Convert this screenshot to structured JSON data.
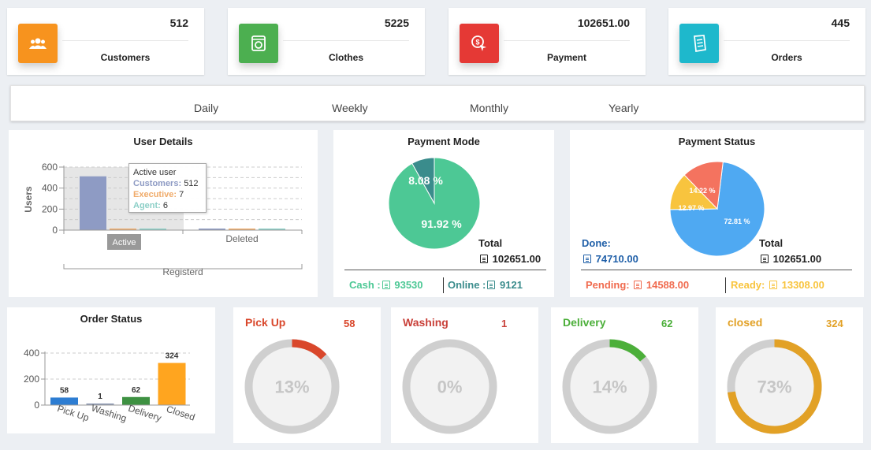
{
  "stats": [
    {
      "value": "512",
      "label": "Customers",
      "color": "#f7931e",
      "icon": "users-icon"
    },
    {
      "value": "5225",
      "label": "Clothes",
      "color": "#4caf50",
      "icon": "washing-machine-icon"
    },
    {
      "value": "102651.00",
      "label": "Payment",
      "color": "#e53935",
      "icon": "payment-icon"
    },
    {
      "value": "445",
      "label": "Orders",
      "color": "#1eb8cc",
      "icon": "receipt-icon"
    }
  ],
  "tabs": [
    "Daily",
    "Weekly",
    "Monthly",
    "Yearly"
  ],
  "user_details": {
    "title": "User Details",
    "tooltip": {
      "title": "Active user",
      "customers_label": "Customers:",
      "customers": "512",
      "executive_label": "Executive:",
      "executive": "7",
      "agent_label": "Agent:",
      "agent": "6"
    },
    "active_label": "Active"
  },
  "payment_mode": {
    "title": "Payment Mode",
    "total_label": "Total",
    "total": "102651.00",
    "cash_label": "Cash :",
    "cash": "93530",
    "online_label": "Online :",
    "online": "9121"
  },
  "payment_status": {
    "title": "Payment Status",
    "done_label": "Done:",
    "done": "74710.00",
    "total_label": "Total",
    "total": "102651.00",
    "pending_label": "Pending:",
    "pending": "14588.00",
    "ready_label": "Ready:",
    "ready": "13308.00"
  },
  "order_status": {
    "title": "Order Status"
  },
  "rings": [
    {
      "title": "Pick Up",
      "count": "58",
      "percent_label": "13%",
      "fraction": 0.13,
      "color": "#d9472b"
    },
    {
      "title": "Washing",
      "count": "1",
      "percent_label": "0%",
      "fraction": 0.0,
      "color": "#c9413a"
    },
    {
      "title": "Delivery",
      "count": "62",
      "percent_label": "14%",
      "fraction": 0.14,
      "color": "#4caf3a"
    },
    {
      "title": "closed",
      "count": "324",
      "percent_label": "73%",
      "fraction": 0.73,
      "color": "#e2a126"
    }
  ],
  "chart_data": [
    {
      "type": "bar",
      "title": "User Details",
      "ylabel": "Users",
      "categories": [
        "Active",
        "Deleted"
      ],
      "xlabel": "Registerd",
      "series": [
        {
          "name": "Customers",
          "values": [
            512,
            0
          ],
          "color": "#8e9bc4"
        },
        {
          "name": "Executive",
          "values": [
            7,
            0
          ],
          "color": "#f0ab6a"
        },
        {
          "name": "Agent",
          "values": [
            6,
            0
          ],
          "color": "#8ccfc7"
        }
      ],
      "ylim": [
        0,
        600
      ],
      "yticks": [
        0,
        200,
        400,
        600
      ]
    },
    {
      "type": "pie",
      "title": "Payment Mode",
      "labels": [
        "Cash",
        "Online"
      ],
      "values": [
        91.92,
        8.08
      ],
      "value_labels": [
        "91.92 %",
        "8.08 %"
      ],
      "colors": [
        "#4dc895",
        "#3a8c8c"
      ]
    },
    {
      "type": "pie",
      "title": "Payment Status",
      "labels": [
        "Done",
        "Ready",
        "Pending"
      ],
      "values": [
        72.81,
        12.97,
        14.22
      ],
      "value_labels": [
        "72.81 %",
        "12.97 %",
        "14.22 %"
      ],
      "colors": [
        "#4fa9f2",
        "#f8c43e",
        "#f4735f"
      ]
    },
    {
      "type": "bar",
      "title": "Order Status",
      "categories": [
        "Pick Up",
        "Washing",
        "Delivery",
        "Closed"
      ],
      "values": [
        58,
        1,
        62,
        324
      ],
      "colors": [
        "#2d7dd2",
        "#8e9bb5",
        "#3e9142",
        "#ffa51f"
      ],
      "ylim": [
        0,
        400
      ],
      "yticks": [
        0,
        200,
        400
      ]
    }
  ]
}
